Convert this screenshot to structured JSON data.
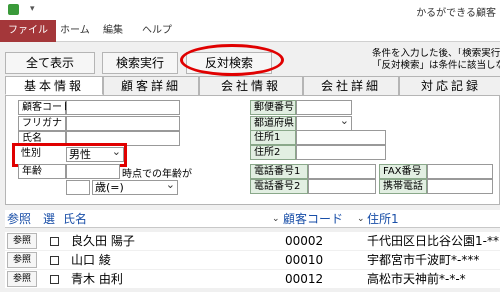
{
  "window": {
    "title": "かるができる顧客"
  },
  "ribbon": {
    "tabs": [
      "ファイル",
      "ホーム",
      "編集",
      "ヘルプ"
    ]
  },
  "toolbar": {
    "show_all": "全て表示",
    "search": "検索実行",
    "reverse": "反対検索"
  },
  "hint": {
    "line1": "条件を入力した後、「検索実行」",
    "line2": "「反対検索」は条件に該当しな"
  },
  "tabs": [
    "基本情報",
    "顧客詳細",
    "会社情報",
    "会社詳細",
    "対応記録"
  ],
  "form": {
    "customer_code_label": "顧客コード",
    "furigana_label": "フリガナ",
    "name_label": "氏名",
    "gender_label": "性別",
    "gender_value": "男性",
    "age_label": "年齢",
    "age_at_text": "時点での年齢が",
    "age_cond_value": "歳(=)",
    "postal_label": "郵便番号",
    "prefecture_label": "都道府県",
    "address1_label": "住所1",
    "address2_label": "住所2",
    "phone1_label": "電話番号1",
    "phone2_label": "電話番号2",
    "fax_label": "FAX番号",
    "mobile_label": "携帯電話"
  },
  "grid": {
    "headers": {
      "ref": "参照",
      "select": "選",
      "name": "氏名",
      "code": "顧客コード",
      "address": "住所1"
    },
    "rows": [
      {
        "ref": "参照",
        "name": "良久田 陽子",
        "code": "00002",
        "address": "千代田区日比谷公園1-**"
      },
      {
        "ref": "参照",
        "name": "山口 綾",
        "code": "00010",
        "address": "宇都宮市千波町*-***"
      },
      {
        "ref": "参照",
        "name": "青木 由利",
        "code": "00012",
        "address": "高松市天神前*-*-*"
      }
    ]
  },
  "colors": {
    "file_tab": "#a4373a",
    "highlight": "#e00000",
    "header_text": "#1a4fa8",
    "green_label": "#e2efe2"
  }
}
